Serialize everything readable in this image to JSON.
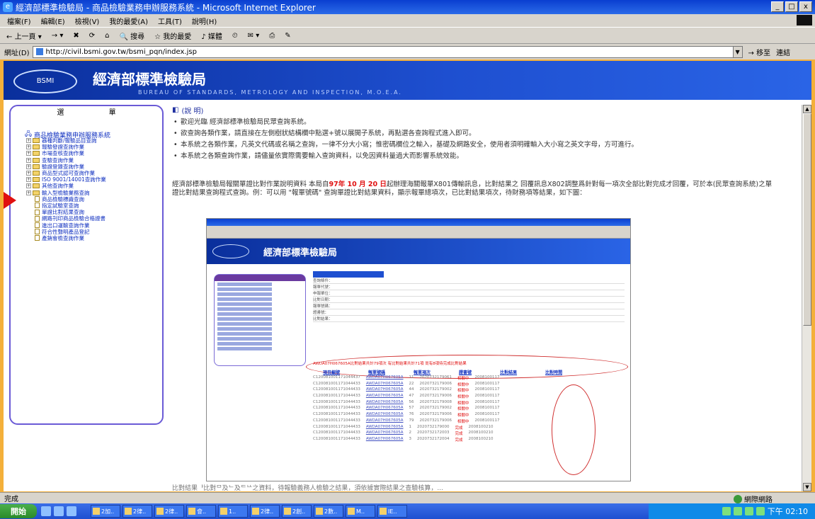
{
  "window": {
    "title": "經濟部標準檢驗局 - 商品檢驗業務申辦服務系統 - Microsoft Internet Explorer",
    "controls": [
      "_",
      "□",
      "x"
    ]
  },
  "menu": [
    "檔案(F)",
    "編輯(E)",
    "檢視(V)",
    "我的最愛(A)",
    "工具(T)",
    "說明(H)"
  ],
  "toolbar": {
    "back": "上一頁",
    "search": "搜尋",
    "favorites": "我的最愛",
    "media": "媒體"
  },
  "address": {
    "label": "網址(D)",
    "url": "http://civil.bsmi.gov.tw/bsmi_pqn/index.jsp",
    "go": "移至",
    "links": "連結"
  },
  "banner": {
    "name": "經濟部標準檢驗局",
    "logo": "BSMI",
    "english": "BUREAU OF STANDARDS, METROLOGY AND INSPECTION, M.O.E.A."
  },
  "sidebar": {
    "header": "選 單",
    "root": "商品檢驗業務申辦服務系統",
    "items": [
      {
        "label": "器種判斷/報驗品目查詢",
        "kind": "folder"
      },
      {
        "label": "報驗發證查詢作業",
        "kind": "folder"
      },
      {
        "label": "市場查核查詢作業",
        "kind": "folder"
      },
      {
        "label": "查驗查詢作業",
        "kind": "folder"
      },
      {
        "label": "驗證登錄查詢作業",
        "kind": "folder"
      },
      {
        "label": "商品型式認可查詢作業",
        "kind": "folder"
      },
      {
        "label": "ISO 9001/14001查詢作業",
        "kind": "folder"
      },
      {
        "label": "其他查詢作業",
        "kind": "folder"
      },
      {
        "label": "輸入型檢驗業務查詢",
        "kind": "folder"
      },
      {
        "label": "商品檢驗標識查詢",
        "kind": "doc"
      },
      {
        "label": "指定試驗室查詢",
        "kind": "doc"
      },
      {
        "label": "單證比對結果查詢",
        "kind": "doc"
      },
      {
        "label": "網路刊印商品檢驗合格證書",
        "kind": "doc"
      },
      {
        "label": "進出口運輸查詢作業",
        "kind": "doc"
      },
      {
        "label": "符合性聲明產品登記",
        "kind": "doc"
      },
      {
        "label": "產銷會檢查詢作業",
        "kind": "doc"
      }
    ]
  },
  "main": {
    "heading": "(說 明)",
    "bullets": [
      "歡迎光臨 經濟部標準檢驗局民眾查詢系統。",
      "欲查詢各類作業，請直接在左側樹狀結構欄中點選+號以展開子系統，再點選各查詢程式進入即可。",
      "本系統之各類作業，凡英文代碼或名稱之查詢，一律不分大小寫；惟密碼欄位之輸入，基礎及網路安全，使用者須明確輸入大小寫之英文字母，方可進行。",
      "本系統之各類查詢作業，請儘量依實際需要輸入查詢資料，以免因資料量過大而影響系統效能。"
    ],
    "para_before": "經濟部標準檢驗局報關單證比對作業說明資料 本局自",
    "para_date": "97年 10 月 20 日",
    "para_after": "起辦理海關報單X801傳輸訊息，比對結果之 回覆訊息X802調整爲針對每一項次全部比對完成才回覆，可於本(民眾查詢系統)之單證比對結果查詢程式查詢。例：可以用 \"報單號碼\" 查詢單證比對結果資料，顯示報單總項次，已比對結果項次，待財務項等結果，如下圖：",
    "bottom": "比對結果ᅡ比對ᄆ及ᄂ及ᄃᄂᄉ之資料，待報驗義務人檢驗之結果，須依據實際結果之查驗核算，..."
  },
  "inner": {
    "note": "AWDA07H067605A比對結果共計79項次 有比對結果共計71項 尚有8項待完成比對結果",
    "headers": [
      "項目編號",
      "報單號碼",
      "報單項次",
      "證書號",
      "比對結果",
      "比對時間"
    ],
    "rows": [
      [
        "C120081001171044437",
        "AWDA07H067605A",
        "11",
        "2020732179061",
        "相關中",
        "2008100117"
      ],
      [
        "C120081001171044433",
        "AWDA07H067605A",
        "22",
        "2020732179006",
        "相關中",
        "2008100117"
      ],
      [
        "C120081001171044433",
        "AWDA07H067605A",
        "44",
        "2020732179002",
        "相關中",
        "2008100117"
      ],
      [
        "C120081001171044433",
        "AWDA07H067605A",
        "47",
        "2020732179006",
        "相關中",
        "2008100117"
      ],
      [
        "C120081001171044433",
        "AWDA07H067605A",
        "56",
        "2020732179008",
        "相關中",
        "2008100117"
      ],
      [
        "C120081001171044433",
        "AWDA07H067605A",
        "57",
        "2020732179002",
        "相關中",
        "2008100117"
      ],
      [
        "C120081001171044433",
        "AWDA07H067605A",
        "76",
        "2020732179006",
        "相關中",
        "2008100117"
      ],
      [
        "C120081001171044433",
        "AWDA07H067605A",
        "79",
        "2020732179006",
        "相關中",
        "2008100117"
      ],
      [
        "C120081001171044433",
        "AWDA07H067605A",
        "1",
        "2020732179000",
        "完成",
        "2008100210"
      ],
      [
        "C120081001171044433",
        "AWDA07H067605A",
        "2",
        "2020732172003",
        "完成",
        "2008100210"
      ],
      [
        "C120081001171044433",
        "AWDA07H067605A",
        "3",
        "2020732172004",
        "完成",
        "2008100210"
      ]
    ],
    "form_rows": [
      "查詢條件：",
      "報單代號：",
      "申報單位：",
      "比對日期：",
      "報單號碼：",
      "證書號：",
      "比對結果："
    ]
  },
  "status": {
    "left": "完成",
    "zone": "網際網路"
  },
  "taskbar": {
    "start": "開始",
    "tasks": [
      "2加..",
      "2律..",
      "2律..",
      "會..",
      "1..",
      "2律..",
      "2創..",
      "2數..",
      "M..",
      "IE.."
    ],
    "clock": "下午 02:10"
  }
}
